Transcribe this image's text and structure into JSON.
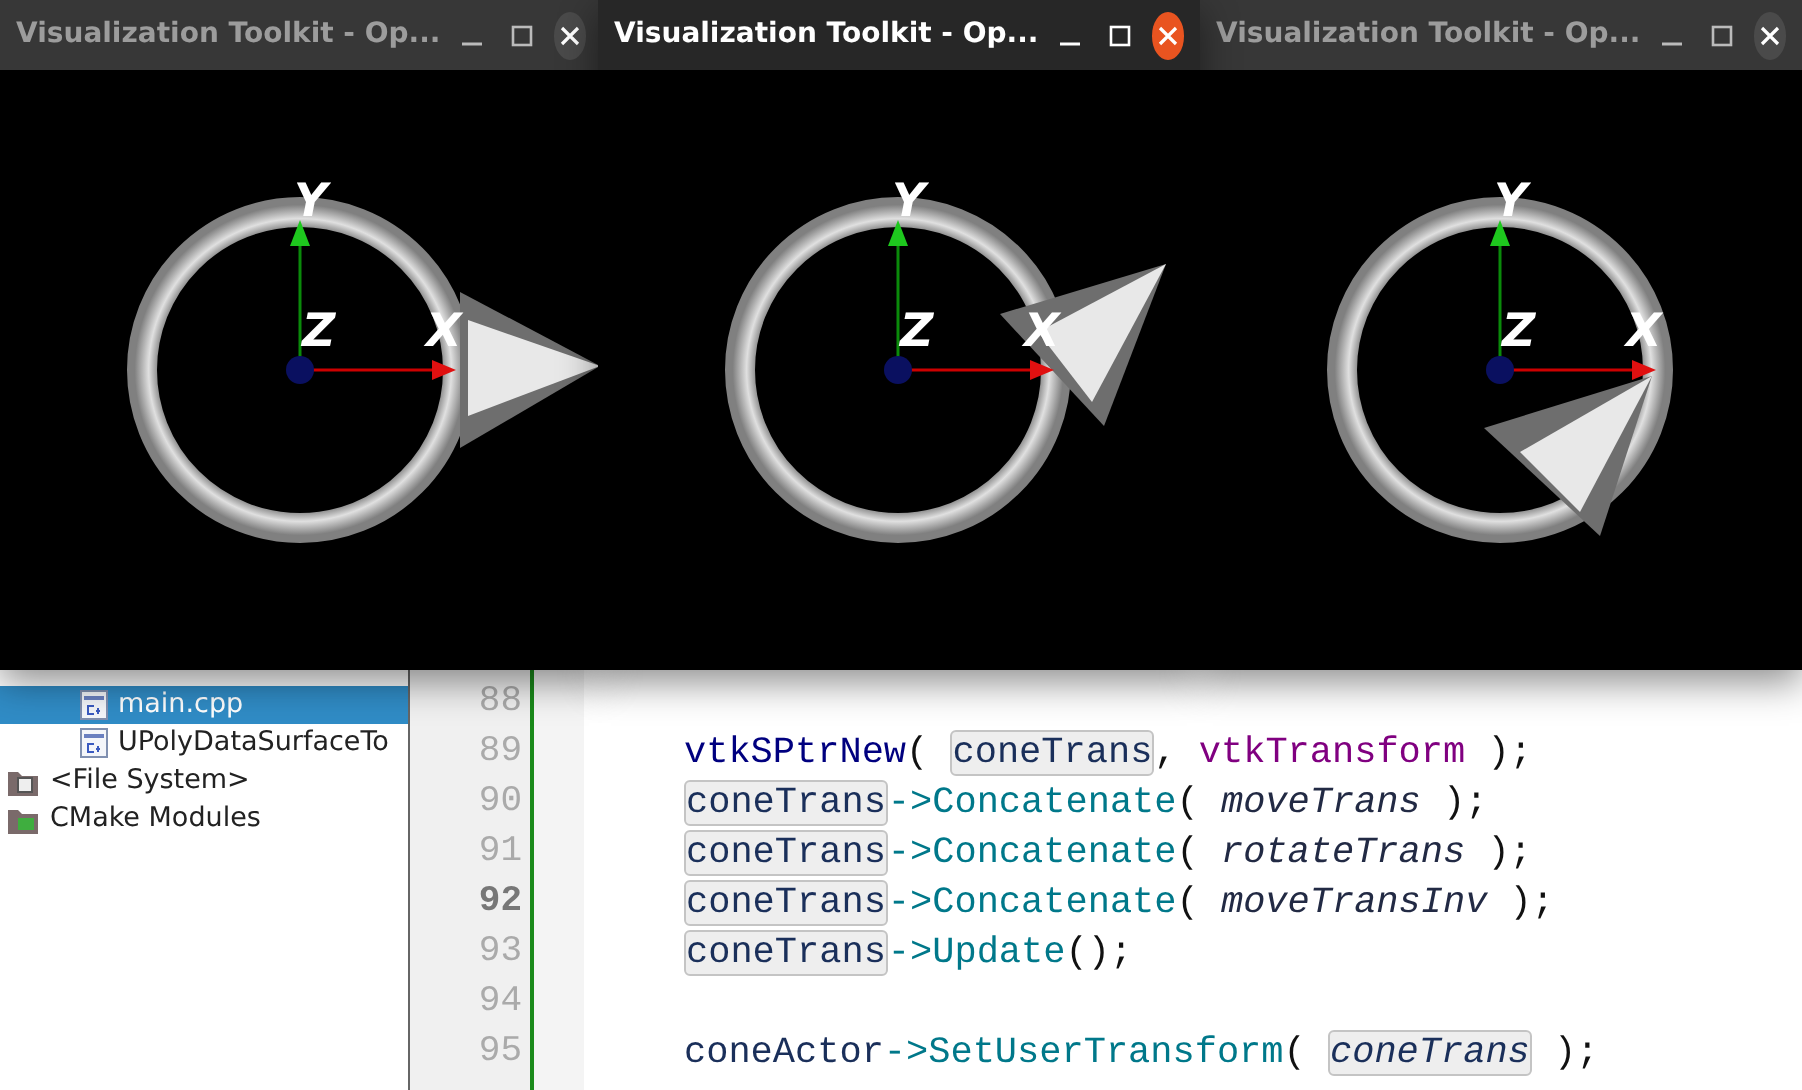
{
  "windows": [
    {
      "title": "Visualization Toolkit - Op...",
      "active": false,
      "axis_labels": [
        "X",
        "Y",
        "Z"
      ]
    },
    {
      "title": "Visualization Toolkit - Op...",
      "active": true,
      "axis_labels": [
        "X",
        "Y",
        "Z"
      ]
    },
    {
      "title": "Visualization Toolkit - Op...",
      "active": false,
      "axis_labels": [
        "X",
        "Y",
        "Z"
      ]
    }
  ],
  "project_tree": [
    {
      "label": "main.cpp",
      "kind": "cpp-file",
      "selected": true
    },
    {
      "label": "UPolyDataSurfaceTo",
      "kind": "cpp-file",
      "selected": false
    },
    {
      "label": "<File System>",
      "kind": "system-folder",
      "selected": false
    },
    {
      "label": "CMake Modules",
      "kind": "cmake-folder",
      "selected": false
    }
  ],
  "editor": {
    "lines": [
      {
        "number": "88",
        "current": false
      },
      {
        "number": "89",
        "current": false,
        "tokens": [
          {
            "text": "vtkSPtrNew",
            "kind": "macro"
          },
          {
            "text": "( ",
            "kind": "punct"
          },
          {
            "text": "coneTrans",
            "kind": "highlight"
          },
          {
            "text": ", ",
            "kind": "punct"
          },
          {
            "text": "vtkTransform",
            "kind": "type"
          },
          {
            "text": " );",
            "kind": "punct"
          }
        ]
      },
      {
        "number": "90",
        "current": false,
        "tokens": [
          {
            "text": "coneTrans",
            "kind": "highlight"
          },
          {
            "text": "->Concatenate",
            "kind": "method"
          },
          {
            "text": "( ",
            "kind": "punct"
          },
          {
            "text": "moveTrans",
            "kind": "param"
          },
          {
            "text": " );",
            "kind": "punct"
          }
        ]
      },
      {
        "number": "91",
        "current": false,
        "tokens": [
          {
            "text": "coneTrans",
            "kind": "highlight"
          },
          {
            "text": "->Concatenate",
            "kind": "method"
          },
          {
            "text": "( ",
            "kind": "punct"
          },
          {
            "text": "rotateTrans",
            "kind": "param"
          },
          {
            "text": " );",
            "kind": "punct"
          }
        ]
      },
      {
        "number": "92",
        "current": true,
        "tokens": [
          {
            "text": "coneTrans",
            "kind": "highlight"
          },
          {
            "text": "->Concatenate",
            "kind": "method"
          },
          {
            "text": "( ",
            "kind": "punct"
          },
          {
            "text": "moveTransInv",
            "kind": "param"
          },
          {
            "text": " );",
            "kind": "punct"
          }
        ]
      },
      {
        "number": "93",
        "current": false,
        "tokens": [
          {
            "text": "coneTrans",
            "kind": "highlight"
          },
          {
            "text": "->Update",
            "kind": "method"
          },
          {
            "text": "();",
            "kind": "punct"
          }
        ]
      },
      {
        "number": "94",
        "current": false
      },
      {
        "number": "95",
        "current": false,
        "tokens": [
          {
            "text": "coneActor",
            "kind": "variable"
          },
          {
            "text": "->SetUserTransform",
            "kind": "method"
          },
          {
            "text": "( ",
            "kind": "punct"
          },
          {
            "text": "coneTrans",
            "kind": "highlight-param"
          },
          {
            "text": " );",
            "kind": "punct"
          }
        ]
      }
    ]
  }
}
